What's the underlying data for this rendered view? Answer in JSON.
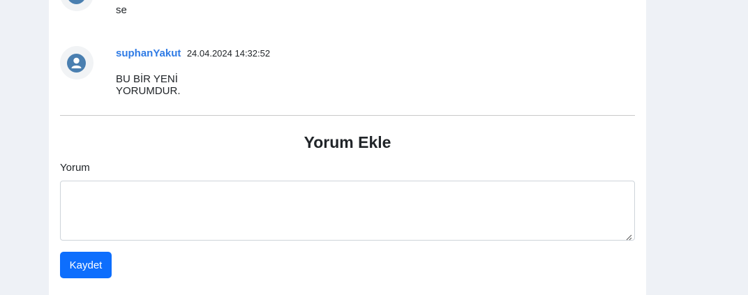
{
  "comments": [
    {
      "avatar_icon": "user-icon",
      "text": "se"
    },
    {
      "avatar_icon": "user-icon",
      "username": "suphanYakut",
      "timestamp": "24.04.2024 14:32:52",
      "text": "BU BİR YENİ YORUMDUR."
    }
  ],
  "form": {
    "title": "Yorum Ekle",
    "label": "Yorum",
    "textarea_value": "",
    "submit_label": "Kaydet"
  },
  "colors": {
    "background": "#eef1f6",
    "card": "#ffffff",
    "username": "#2f7be5",
    "avatar": "#4a7fb0",
    "primary_button": "#0d6efd"
  }
}
